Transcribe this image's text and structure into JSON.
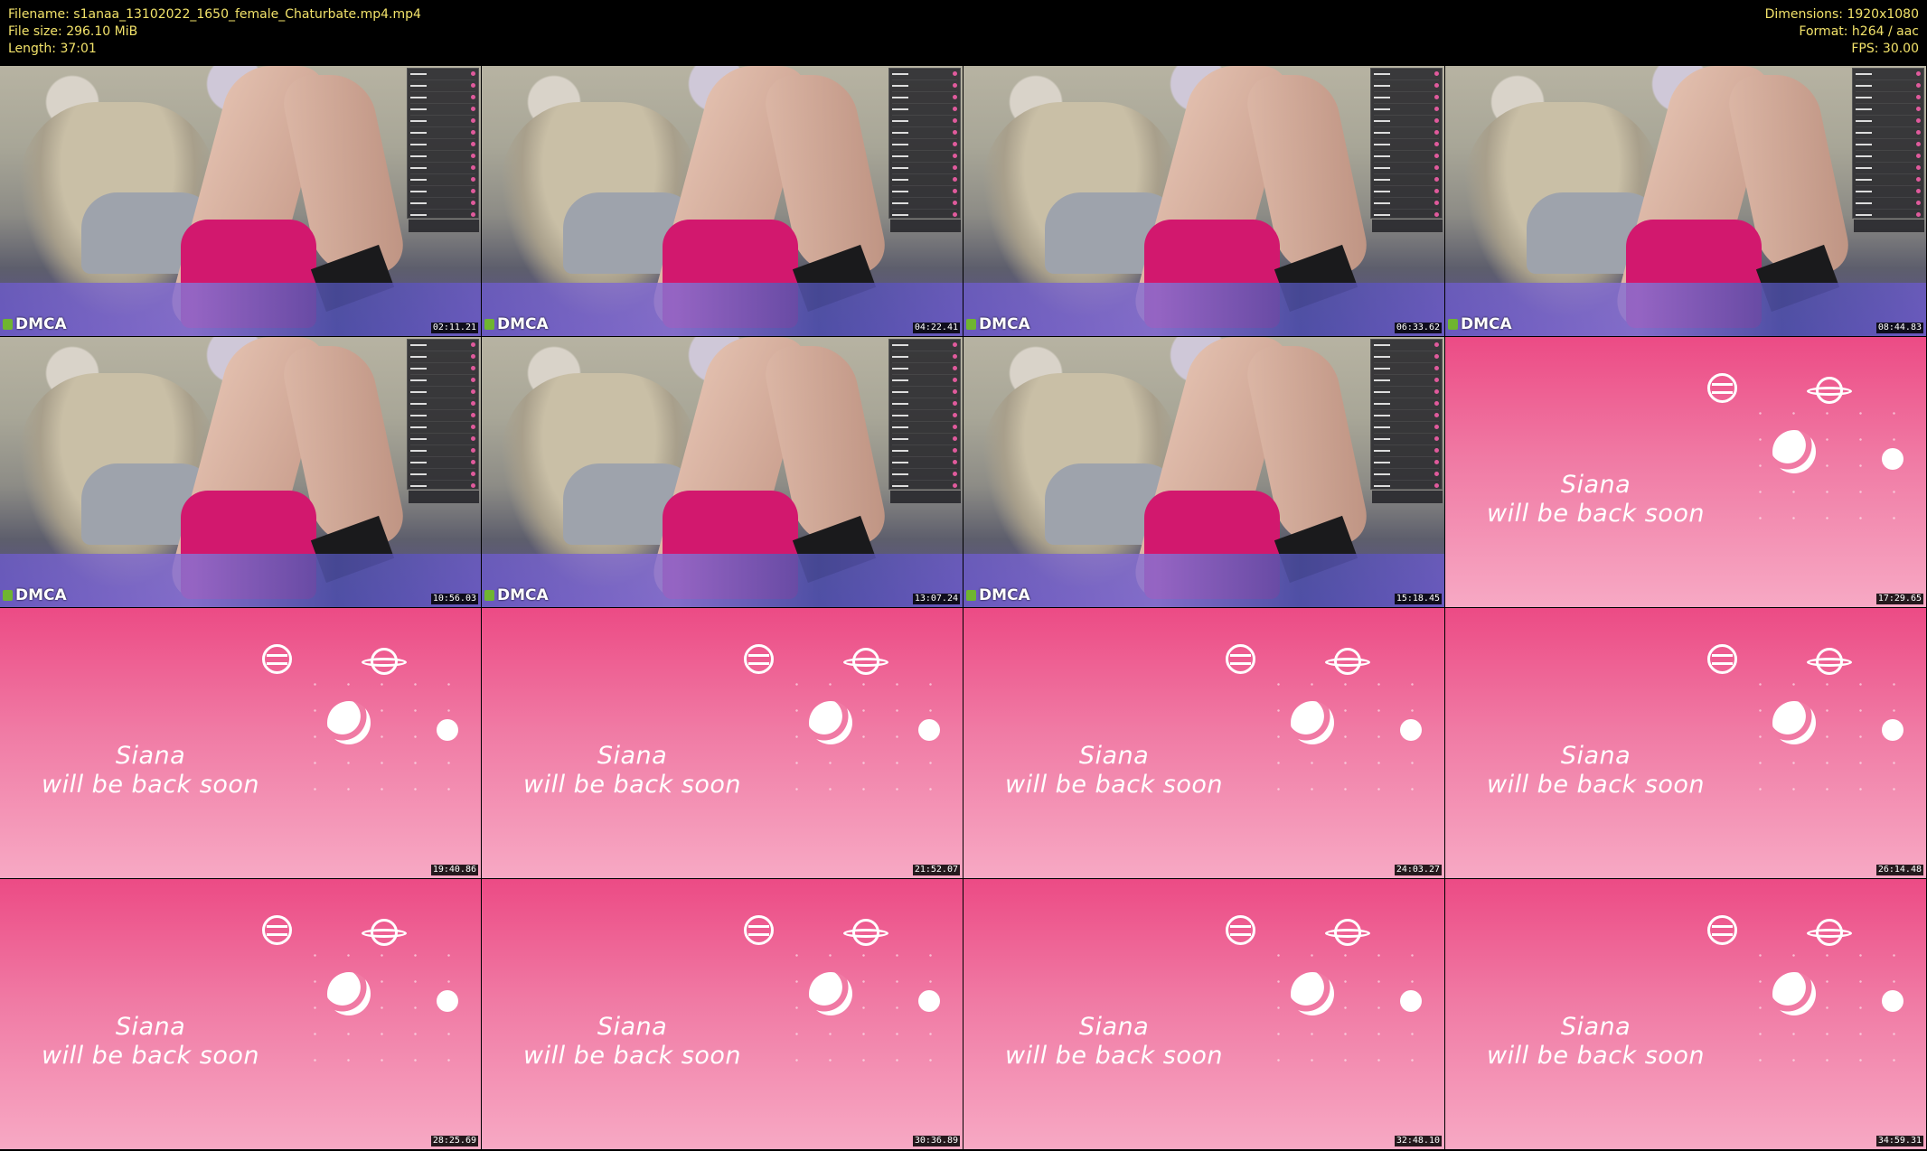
{
  "header": {
    "filename": "Filename: s1anaa_13102022_1650_female_Chaturbate.mp4.mp4",
    "filesize": "File size: 296.10 MiB",
    "length": "Length: 37:01",
    "dimensions": "Dimensions: 1920x1080",
    "format": "Format: h264 / aac",
    "fps": "FPS: 30.00"
  },
  "colors": {
    "header_text": "#f2e26a",
    "away_pink_top": "#ec4b85",
    "away_pink_bottom": "#f7a9c4",
    "shorts_magenta": "#d2186e"
  },
  "watermark": "DMCA",
  "away_message": {
    "name": "Siana",
    "line2": "will be back soon"
  },
  "thumbnails": [
    {
      "type": "cam",
      "timestamp": "02:11.21"
    },
    {
      "type": "cam",
      "timestamp": "04:22.41"
    },
    {
      "type": "cam",
      "timestamp": "06:33.62"
    },
    {
      "type": "cam",
      "timestamp": "08:44.83"
    },
    {
      "type": "cam",
      "timestamp": "10:56.03"
    },
    {
      "type": "cam",
      "timestamp": "13:07.24"
    },
    {
      "type": "cam",
      "timestamp": "15:18.45"
    },
    {
      "type": "away",
      "timestamp": "17:29.65"
    },
    {
      "type": "away",
      "timestamp": "19:40.86"
    },
    {
      "type": "away",
      "timestamp": "21:52.07"
    },
    {
      "type": "away",
      "timestamp": "24:03.27"
    },
    {
      "type": "away",
      "timestamp": "26:14.48"
    },
    {
      "type": "away",
      "timestamp": "28:25.69"
    },
    {
      "type": "away",
      "timestamp": "30:36.89"
    },
    {
      "type": "away",
      "timestamp": "32:48.10"
    },
    {
      "type": "away",
      "timestamp": "34:59.31"
    }
  ]
}
